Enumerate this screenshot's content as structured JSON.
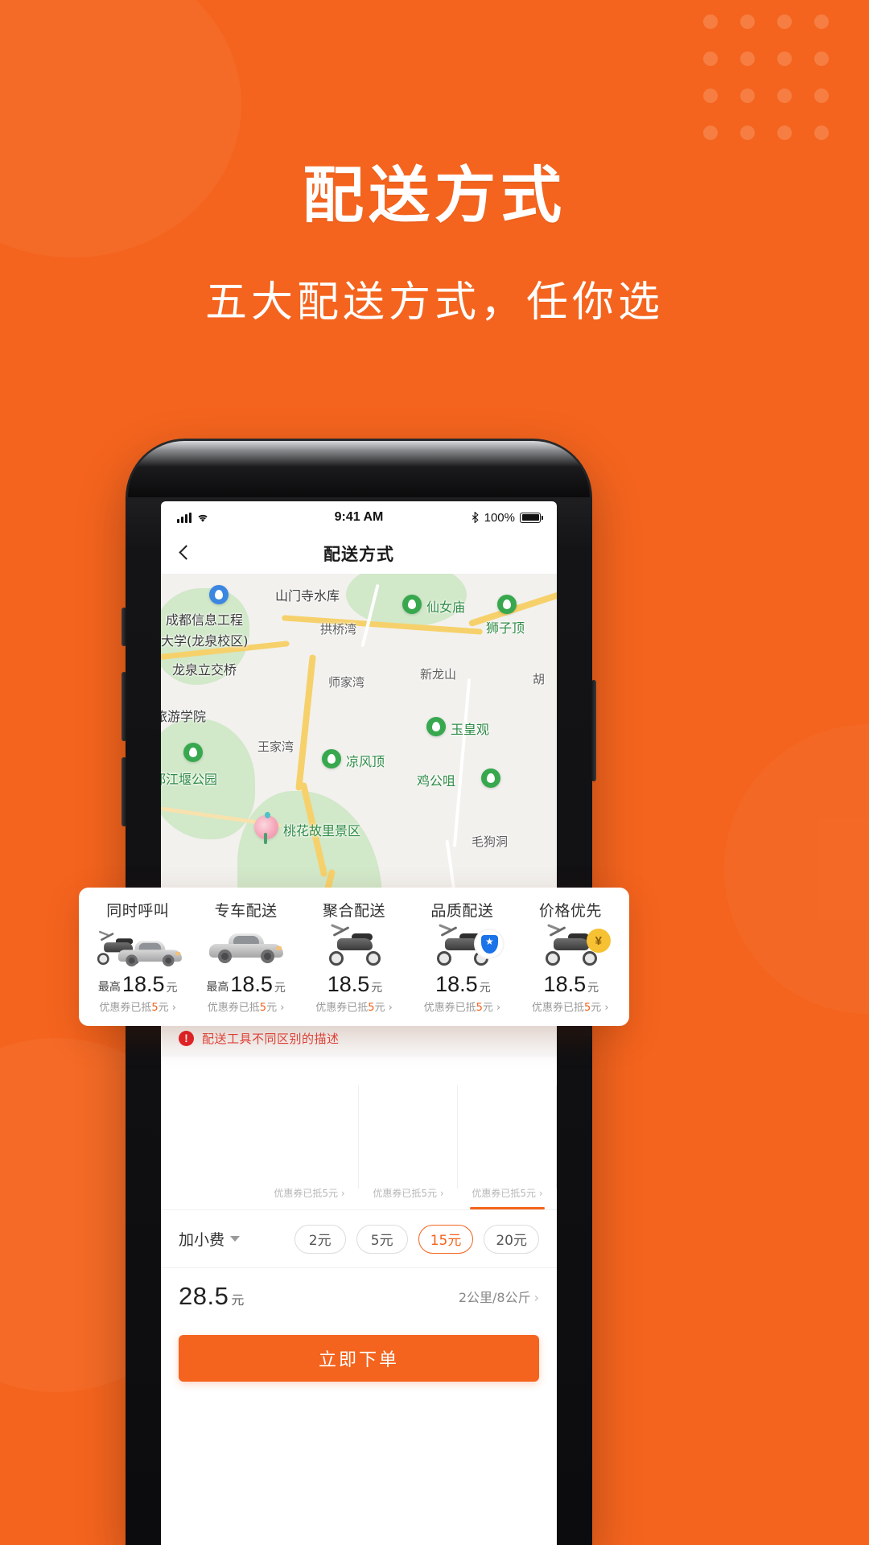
{
  "theme": {
    "brand_orange": "#F4641E",
    "alert_red": "#E8443D",
    "map_green": "#37A84E"
  },
  "headline": {
    "title": "配送方式",
    "subtitle": "五大配送方式，任你选"
  },
  "phone": {
    "status_bar": {
      "time": "9:41 AM",
      "battery_percent": "100%",
      "bluetooth_icon": "bluetooth-icon",
      "wifi_icon": "wifi-icon",
      "signal_icon": "signal-bars-icon"
    },
    "nav": {
      "back_icon": "back-chevron-icon",
      "title": "配送方式"
    },
    "map": {
      "labels": [
        "山门寺水库",
        "成都信息工程",
        "大学(龙泉校区)",
        "拱桥湾",
        "仙女庙",
        "狮子顶",
        "龙泉立交桥",
        "师家湾",
        "新龙山",
        "胡",
        "旅游学院",
        "玉皇观",
        "王家湾",
        "凉风顶",
        "鸡公咀",
        "都江堰公园",
        "桃花故里景区",
        "毛狗洞"
      ]
    },
    "warning": {
      "icon": "exclamation-icon",
      "text": "配送工具不同区别的描述"
    },
    "tip": {
      "label": "加小费",
      "caret_icon": "chevron-down-icon",
      "options": [
        "2元",
        "5元",
        "15元",
        "20元"
      ],
      "selected": "15元"
    },
    "total": {
      "amount": "28.5",
      "unit": "元",
      "meta": "2公里/8公斤",
      "meta_arrow": "›"
    },
    "order_button": "立即下单",
    "inner_coupons": [
      "优惠券已抵5元 ›",
      "优惠券已抵5元 ›",
      "优惠券已抵5元 ›"
    ]
  },
  "float_card": {
    "options": [
      {
        "name": "同时呼叫",
        "art": "scooter-and-car-icon",
        "price_prefix": "最高",
        "price": "18.5",
        "unit": "元",
        "coupon_pre": "优惠券已抵",
        "coupon_amt": "5",
        "coupon_post": "元 ›"
      },
      {
        "name": "专车配送",
        "art": "car-icon",
        "price_prefix": "最高",
        "price": "18.5",
        "unit": "元",
        "coupon_pre": "优惠券已抵",
        "coupon_amt": "5",
        "coupon_post": "元 ›"
      },
      {
        "name": "聚合配送",
        "art": "scooter-icon",
        "price_prefix": "",
        "price": "18.5",
        "unit": "元",
        "coupon_pre": "优惠券已抵",
        "coupon_amt": "5",
        "coupon_post": "元 ›"
      },
      {
        "name": "品质配送",
        "art": "scooter-shield-icon",
        "price_prefix": "",
        "price": "18.5",
        "unit": "元",
        "coupon_pre": "优惠券已抵",
        "coupon_amt": "5",
        "coupon_post": "元 ›"
      },
      {
        "name": "价格优先",
        "art": "scooter-money-icon",
        "price_prefix": "",
        "price": "18.5",
        "unit": "元",
        "coupon_pre": "优惠券已抵",
        "coupon_amt": "5",
        "coupon_post": "元 ›"
      }
    ]
  }
}
